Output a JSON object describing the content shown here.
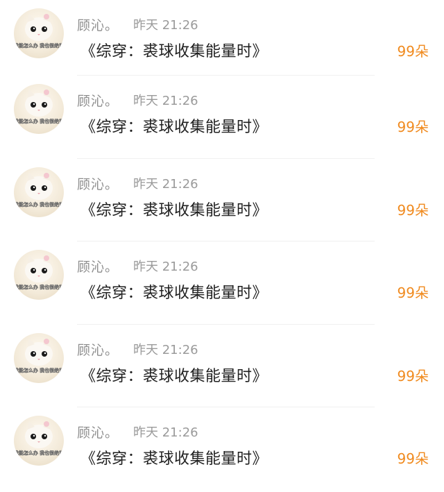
{
  "items": [
    {
      "name": "顾沁。",
      "time": "昨天 21:26",
      "title": "《综穿：裘球收集能量时》",
      "count": "99朵",
      "avatar_text": "我能怎么办 我也很绝望"
    },
    {
      "name": "顾沁。",
      "time": "昨天 21:26",
      "title": "《综穿：裘球收集能量时》",
      "count": "99朵",
      "avatar_text": "我能怎么办 我也很绝望"
    },
    {
      "name": "顾沁。",
      "time": "昨天 21:26",
      "title": "《综穿：裘球收集能量时》",
      "count": "99朵",
      "avatar_text": "我能怎么办 我也很绝望"
    },
    {
      "name": "顾沁。",
      "time": "昨天 21:26",
      "title": "《综穿：裘球收集能量时》",
      "count": "99朵",
      "avatar_text": "我能怎么办 我也很绝望"
    },
    {
      "name": "顾沁。",
      "time": "昨天 21:26",
      "title": "《综穿：裘球收集能量时》",
      "count": "99朵",
      "avatar_text": "我能怎么办 我也很绝望"
    },
    {
      "name": "顾沁。",
      "time": "昨天 21:26",
      "title": "《综穿：裘球收集能量时》",
      "count": "99朵",
      "avatar_text": "我能怎么办 我也很绝望"
    }
  ],
  "colors": {
    "count": "#f08a1e",
    "meta": "#9a9a9a",
    "title": "#1f1f1f"
  },
  "icons": {
    "avatar": "cat-avatar-icon"
  }
}
